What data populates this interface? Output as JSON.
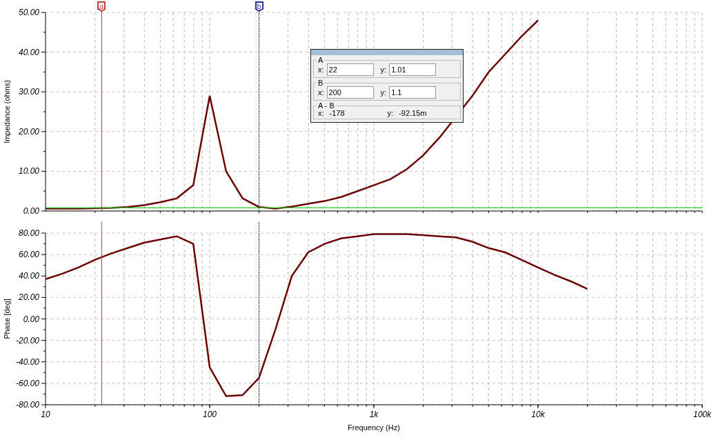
{
  "cursors": [
    {
      "label": "a",
      "color": "#c04040"
    },
    {
      "label": "b",
      "color": "#3030a0"
    }
  ],
  "impedance_chart": {
    "chart_data": {
      "type": "line",
      "ylabel": "Impedance (ohms)",
      "grid": true,
      "ylim": [
        0,
        50
      ],
      "yticks": [
        {
          "value": 0,
          "label": "0.00"
        },
        {
          "value": 10,
          "label": "10.00"
        },
        {
          "value": 20,
          "label": "20.00"
        },
        {
          "value": 30,
          "label": "30.00"
        },
        {
          "value": 40,
          "label": "40.00"
        },
        {
          "value": 50,
          "label": "50.00"
        }
      ],
      "categories": [
        null,
        null,
        null,
        null,
        null,
        null,
        null,
        null,
        null,
        null,
        null,
        null,
        null,
        null,
        null,
        null,
        null,
        null,
        null,
        null,
        null,
        null,
        null,
        null,
        null,
        null,
        null,
        null,
        null,
        null,
        null,
        null,
        null,
        null,
        null,
        null,
        null,
        null,
        null,
        null,
        null
      ],
      "series": [
        {
          "color": "#6b0000",
          "values": [
            0.6,
            0.6,
            0.6,
            0.7,
            0.8,
            1.0,
            1.5,
            2.2,
            3.2,
            6.5,
            29,
            10,
            3.2,
            1.0,
            0.6,
            1.1,
            1.8,
            2.5,
            3.5,
            5,
            6.5,
            8,
            10.5,
            14,
            18.5,
            null,
            29,
            35,
            39.5,
            44,
            48,
            null,
            null,
            null,
            null,
            null,
            null,
            null,
            null,
            null,
            null
          ]
        },
        {
          "color": "#22cc22",
          "values": [
            0.8,
            0.8,
            0.8,
            0.8,
            0.8,
            0.8,
            0.8,
            0.8,
            0.8,
            0.8,
            0.8,
            0.8,
            0.8,
            0.8,
            0.8,
            0.8,
            0.8,
            0.8,
            0.8,
            0.8,
            0.8,
            0.8,
            0.8,
            0.8,
            0.8,
            0.8,
            0.8,
            0.8,
            0.8,
            0.8,
            0.8,
            0.8,
            0.8,
            0.8,
            0.8,
            0.8,
            0.8,
            0.8,
            0.8,
            0.8,
            0.8
          ]
        }
      ]
    }
  },
  "phase_chart": {
    "chart_data": {
      "type": "line",
      "xlabel": "Frequency (Hz)",
      "ylabel": "Phase [deg]",
      "grid": true,
      "ylim": [
        -80,
        80
      ],
      "yticks": [
        {
          "value": -80,
          "label": "-80.00"
        },
        {
          "value": -60,
          "label": "-60.00"
        },
        {
          "value": -40,
          "label": "-40.00"
        },
        {
          "value": -20,
          "label": "-20.00"
        },
        {
          "value": 0,
          "label": "0.00"
        },
        {
          "value": 20,
          "label": "20.00"
        },
        {
          "value": 40,
          "label": "40.00"
        },
        {
          "value": 60,
          "label": "60.00"
        },
        {
          "value": 80,
          "label": "80.00"
        }
      ],
      "categories": [
        "10",
        null,
        null,
        null,
        null,
        null,
        null,
        null,
        null,
        null,
        "100",
        null,
        null,
        null,
        null,
        null,
        null,
        null,
        null,
        null,
        "1k",
        null,
        null,
        null,
        null,
        null,
        null,
        null,
        null,
        null,
        "10k",
        null,
        null,
        null,
        null,
        null,
        null,
        null,
        null,
        null,
        "100k"
      ],
      "series": [
        {
          "color": "#6b0000",
          "values": [
            37,
            42,
            48,
            55,
            61,
            66,
            71,
            74,
            77,
            70,
            -45,
            -72,
            -71,
            -55,
            -10,
            40,
            62,
            70,
            75,
            77,
            79,
            79,
            79,
            78,
            77,
            76,
            72,
            66,
            62,
            55,
            48,
            41,
            35,
            28,
            null,
            null,
            null,
            null,
            null,
            null,
            null
          ]
        }
      ]
    }
  },
  "cursor_panel": {
    "groups": [
      {
        "kind": "inputs",
        "label": "A",
        "fields": [
          {
            "label": "x:",
            "value": "22"
          },
          {
            "label": "y:",
            "value": "1.01"
          }
        ]
      },
      {
        "kind": "inputs",
        "label": "B",
        "fields": [
          {
            "label": "x:",
            "value": "200"
          },
          {
            "label": "y:",
            "value": "1.1"
          }
        ]
      },
      {
        "kind": "readout",
        "label": "A - B",
        "fields": [
          {
            "label": "x:",
            "value": "-178"
          },
          {
            "label": "y:",
            "value": "-92.15m"
          }
        ]
      }
    ]
  }
}
